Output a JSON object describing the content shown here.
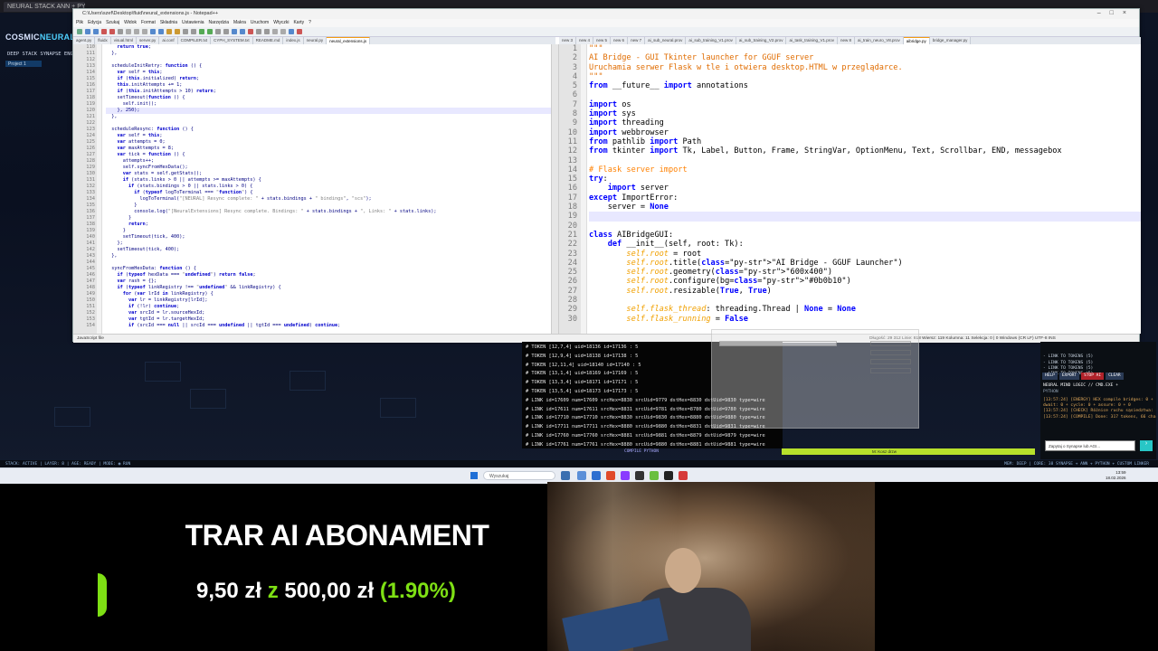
{
  "browser": {
    "tab_title": "NEURAL STACK ANN + PYTHON E"
  },
  "app": {
    "brand_cosmic": "COSMIC",
    "brand_neural": "NEURAL ST",
    "subtitle": "DEEP STACK SYNAPSE ENGINE",
    "project_tab": "Project 1"
  },
  "notepad": {
    "title": "C:\\Users\\szef\\Desktop\\fluid\\neural_extensions.js - Notepad++",
    "menu": [
      "Plik",
      "Edycja",
      "Szukaj",
      "Widok",
      "Format",
      "Składnia",
      "Ustawienia",
      "Narzędzia",
      "Makra",
      "Uruchom",
      "Wtyczki",
      "Karty",
      "?"
    ],
    "tabs_left": [
      "agent.py",
      "fluidx",
      "visual.html",
      "server.py",
      "ai.conf",
      "COMPILER.txt",
      "CYPH_SYSTEM.txt",
      "README.md",
      "index.js",
      "neural.py",
      "neural_extensions.js"
    ],
    "tabs_right": [
      "new 3",
      "new 4",
      "new 5",
      "new 6",
      "new 7",
      "ai_sub_neural.prov",
      "ai_sub_training_V1.prov",
      "ai_sub_training_V2.prov",
      "ai_task_training_V1.prov",
      "new 8",
      "ai_train_neuro_V8.prov",
      "aibridge.py",
      "bridge_manager.py"
    ],
    "active_left_tab": "neural_extensions.js",
    "active_right_tab": "aibridge.py",
    "left_start_line": 110,
    "left_lines": [
      "    return true;",
      "  },",
      "",
      "  scheduleInitRetry: function () {",
      "    var self = this;",
      "    if (this.initialized) return;",
      "    this.initAttempts += 1;",
      "    if (this.initAttempts > 10) return;",
      "    setTimeout(function () {",
      "      self.init();",
      "    }, 250);",
      "  },",
      "",
      "  scheduleResync: function () {",
      "    var self = this;",
      "    var attempts = 0;",
      "    var maxAttempts = 8;",
      "    var tick = function () {",
      "      attempts++;",
      "      self.syncFromHexData();",
      "      var stats = self.getStats();",
      "      if (stats.links > 0 || attempts >= maxAttempts) {",
      "        if (stats.bindings > 0 || stats.links > 0) {",
      "          if (typeof logToTerminal === \"function\") {",
      "            logToTerminal(\"[NEURAL] Resync complete: \" + stats.bindings + \" bindings\", \"scs\");",
      "          }",
      "          console.log(\"[NeuralExtensions] Resync complete. Bindings: \" + stats.bindings + \", Links: \" + stats.links);",
      "        }",
      "        return;",
      "      }",
      "      setTimeout(tick, 400);",
      "    };",
      "    setTimeout(tick, 400);",
      "  },",
      "",
      "  syncFromHexData: function () {",
      "    if (typeof hexData === \"undefined\") return false;",
      "    var rash = {};",
      "    if (typeof linkRegistry !== \"undefined\" && linkRegistry) {",
      "      for (var lrId in linkRegistry) {",
      "        var lr = linkRegistry[lrId];",
      "        if (!lr) continue;",
      "        var srcId = lr.sourceHexId;",
      "        var tgtId = lr.targetHexId;",
      "        if (srcId === null || srcId === undefined || tgtId === undefined) continue;"
    ],
    "right_start_line": 1,
    "right_lines": [
      "\"\"\"",
      "AI Bridge - GUI Tkinter launcher for GGUF server",
      "Uruchamia serwer Flask w tle i otwiera desktop.HTML w przeglądarce.",
      "\"\"\"",
      "from __future__ import annotations",
      "",
      "import os",
      "import sys",
      "import threading",
      "import webbrowser",
      "from pathlib import Path",
      "from tkinter import Tk, Label, Button, Frame, StringVar, OptionMenu, Text, Scrollbar, END, messagebox",
      "",
      "# Flask server import",
      "try:",
      "    import server",
      "except ImportError:",
      "    server = None",
      "",
      "",
      "class AIBridgeGUI:",
      "    def __init__(self, root: Tk):",
      "        self.root = root",
      "        self.root.title(\"AI Bridge - GGUF Launcher\")",
      "        self.root.geometry(\"600x400\")",
      "        self.root.configure(bg=\"#0b0b10\")",
      "        self.root.resizable(True, True)",
      "",
      "        self.flask_thread: threading.Thread | None = None",
      "        self.flask_running = False"
    ],
    "status_left": "JavaScript file",
    "status_right": "Długość: 29 312   Linie: 818      Wiersz: 119   Kolumna: 11   Selekcja: 0 | 0        Windows (CR LF)   UTF-8     INS"
  },
  "console": {
    "lines": [
      "# TOKEN [12,7,4] uid=18136 id=17136 : 5",
      "# TOKEN [12,9,4] uid=18138 id=17138 : 5",
      "# TOKEN [12,11,4] uid=18140 id=17140 : 5",
      "# TOKEN [13,1,4] uid=18169 id=17169 : 5",
      "# TOKEN [13,3,4] uid=18171 id=17171 : 5",
      "# TOKEN [13,5,4] uid=18173 id=17173 : 5",
      "# LINK id=17609 num=17609 srcHex=8830 srcUid=9779 dstHex=8830 dstUid=9830 type=wire",
      "# LINK id=17611 num=17611 srcHex=8831 srcUid=9781 dstHex=8780 dstUid=9780 type=wire",
      "# LINK id=17710 num=17710 srcHex=8830 srcUid=9830 dstHex=8880 dstUid=9880 type=wire",
      "# LINK id=17711 num=17711 srcHex=8880 srcUid=9880 dstHex=8831 dstUid=9831 type=wire",
      "# LINK id=17760 num=17760 srcHex=8881 srcUid=9881 dstHex=8879 dstUid=9879 type=wire",
      "# LINK id=17761 num=17761 srcHex=8880 srcUid=9880 dstHex=8881 dstUid=9881 type=wire"
    ],
    "compile_label": "COMPILE PYTHON",
    "progress_label": "M: Kosz drzw"
  },
  "log": {
    "top_lines": [
      "- LINK TO TOKENS (5)",
      "- LINK TO TOKENS (5)",
      "- LINK TO TOKENS (5)",
      "- LINK TO TOKENS (5)"
    ],
    "buttons": [
      "HELP",
      "EXPORT",
      "STOP AI",
      "CLEAR"
    ],
    "header": "NEURAL MIND LOGIC // CMD.EXE +",
    "sub": "PYTHON",
    "lines": [
      "[13:57:24] [ENERGY] HEX compile bridges: 0 +",
      "dwait: 0 + cycle: 0 + assure: 0 + 0",
      "[13:57:24] [CHECK] Różnice ruchu sąsiedztwa: L=8052 Z=8052",
      "[13:57:24] [COMPILE] Done: 317 tokens, 66 chains"
    ],
    "input_placeholder": "Zapytaj o Synapse lub AGI...",
    "send_label": "›"
  },
  "status_bar": {
    "left": "STACK: ACTIVE | LAYER: 8 | AGE: READY | MODE: ◉ RUN",
    "right": "MEM: DEEP | CORE: 38 SYNAPSE + ANN + PYTHON + CUSTOM LINKER"
  },
  "taskbar": {
    "search_placeholder": "Wyszukaj",
    "time": "13:59",
    "date": "18.02.2026"
  },
  "promo": {
    "title": "TRAR AI ABONAMENT",
    "current": "9,50 zł",
    "z": "z",
    "goal": "500,00 zł",
    "percent": "(1.90%)",
    "progress_fraction": 0.019,
    "accent": "#7ee014"
  }
}
